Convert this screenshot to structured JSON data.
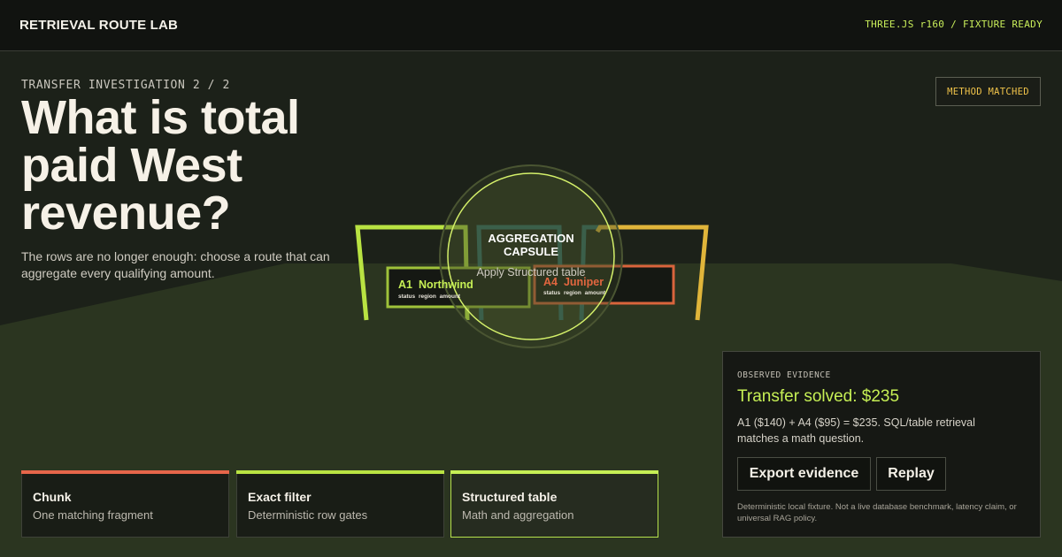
{
  "header": {
    "brand": "RETRIEVAL ROUTE LAB",
    "engine_status": "THREE.JS r160 / FIXTURE READY"
  },
  "investigation": {
    "kicker": "TRANSFER INVESTIGATION 2 / 2",
    "question": "What is total paid West revenue?",
    "subtext": "The rows are no longer enough: choose a route that can aggregate every qualifying amount.",
    "status_badge": "METHOD MATCHED"
  },
  "scene": {
    "capsule_title": "AGGREGATION CAPSULE",
    "capsule_action": "Apply Structured table",
    "cards": [
      {
        "id": "A1",
        "name": "Northwind",
        "columns": "status  region  amount"
      },
      {
        "id": "A4",
        "name": "Juniper",
        "columns": "status  region  amount"
      }
    ],
    "colors": {
      "lime": "#b9e342",
      "teal": "#2f6b68",
      "coral": "#e2663f",
      "amber": "#e0b53a"
    }
  },
  "routes": [
    {
      "title": "Chunk",
      "desc": "One matching fragment",
      "accent": "#e6664a",
      "active": false
    },
    {
      "title": "Exact filter",
      "desc": "Deterministic row gates",
      "accent": "#b9e342",
      "active": false
    },
    {
      "title": "Structured table",
      "desc": "Math and aggregation",
      "accent": "#c6ef55",
      "active": true
    }
  ],
  "evidence": {
    "kicker": "OBSERVED EVIDENCE",
    "title": "Transfer solved: $235",
    "body": "A1 ($140) + A4 ($95) = $235. SQL/table retrieval matches a math question.",
    "export_label": "Export evidence",
    "replay_label": "Replay",
    "note": "Deterministic local fixture. Not a live database benchmark, latency claim, or universal RAG policy."
  }
}
